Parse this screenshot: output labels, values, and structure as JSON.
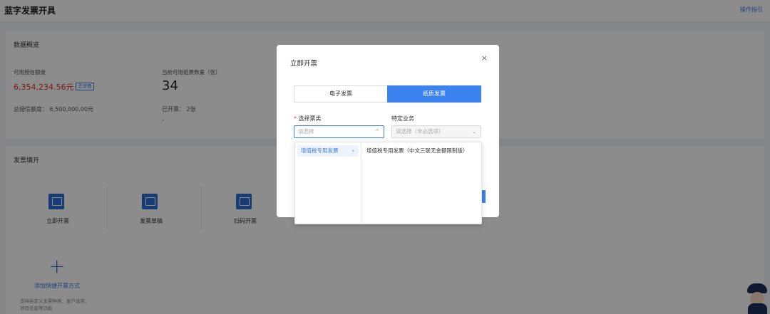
{
  "page": {
    "title": "蓝字发票开具",
    "guide_link": "操作指引"
  },
  "overview": {
    "title": "数据概览",
    "credit_label": "可用授信额度",
    "credit_value": "6,354,234.56元",
    "credit_detail_link": "去详情",
    "paper_label": "当前可用纸票数量（张）",
    "paper_count": "34",
    "total_credit": "总授信额度： 6,500,000.00元",
    "issued": "已开票： 2张",
    "dash": "-"
  },
  "issuance": {
    "title": "发票填开",
    "entries": [
      {
        "label": "立即开票",
        "icon": "invoice-icon"
      },
      {
        "label": "发票草稿",
        "icon": "draft-icon"
      },
      {
        "label": "扫码开票",
        "icon": "qrcode-icon"
      }
    ],
    "add_label": "添加快捷开票方式",
    "add_desc_line1": "支持自定义发票种类、客户选项、",
    "add_desc_line2": "项目信息等功能"
  },
  "modal": {
    "title": "立即开票",
    "close": "×",
    "tabs": [
      {
        "label": "电子发票",
        "active": false
      },
      {
        "label": "纸质发票",
        "active": true
      }
    ],
    "ticket_type": {
      "required_mark": "*",
      "label": "选择票类",
      "placeholder": "请选择",
      "caret": "^"
    },
    "business": {
      "label": "特定业务",
      "placeholder": "请选择（非必选项）",
      "caret": "⌄"
    }
  },
  "dropdown": {
    "category": "增值税专用发票",
    "arrow": "›",
    "option": "增值税专用发票（中文三联无金额限制版）"
  },
  "colors": {
    "accent": "#3b82f0",
    "danger": "#d93025",
    "icon_bg": "#2d6bd6"
  }
}
